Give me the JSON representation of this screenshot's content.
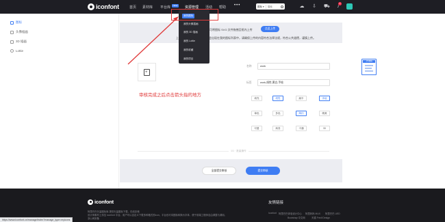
{
  "topnav": {
    "logo": "iconfont",
    "links": [
      "首页",
      "素材库",
      "平台库",
      "资源管理",
      "活动",
      "帮助"
    ],
    "new_badge": "NEW",
    "more": "•••",
    "search": {
      "select": "图标 ▾",
      "placeholder": "搜索"
    },
    "notification_count": "2"
  },
  "dropdown": {
    "items": [
      "我的图标",
      "我的头像插画",
      "我的 3D 插画",
      "我的 Lottie",
      "我的收藏",
      "我的项目"
    ]
  },
  "sidebar": {
    "items": [
      "图标",
      "头像插画",
      "3D 插画",
      "Lottie"
    ]
  },
  "main": {
    "banner_line1": "可将图标 SVG 文件拖拽至框内上传",
    "upload_button": "点此上传",
    "banner_line2": "上传后，审核通过的图标将会出现在我的图标列表中，请确保上传的内容符合法律法规，符合公共道德，谨慎上传。",
    "annotation": "审核完成之后点击箭头指的地方",
    "form": {
      "name_label": "名称",
      "name_value": "work",
      "tags_label": "标签",
      "tags_value": "work,线性,黑白,手绘"
    },
    "chips": [
      [
        "填充",
        "线性",
        "扁平",
        "手绘"
      ],
      [
        "单色",
        "多色",
        "简约",
        "精美"
      ],
      [
        "可爱",
        "商务",
        "卡通",
        "3D"
      ]
    ],
    "divider_text": "1/1 · 批量操作",
    "cancel_button": "全部提交审核",
    "confirm_button": "提交审核"
  },
  "float_card": {
    "title": "上传图标"
  },
  "footer": {
    "logo": "iconfont",
    "text1": "阿里巴巴矢量图标库 提供矢量图标下载、在线存储",
    "text2": "设计师素材上传至 iconfont 平台，用户可以自定义下载多种格式的icon，平台也可将图标转换为字体，便于前端工程师自由调整与调用。",
    "text3": "浙公网安备",
    "links_title": "友情链接",
    "links": [
      "Iconfont",
      "阿里巴巴体验设计中心",
      "阿里妈妈 MUX",
      "阿里巴巴 UED",
      "Bootstrap 中文网",
      "天猫 Fredi Design"
    ]
  },
  "status_bar": "https://www.iconfont.cn/manage/index?manage_type=myicons",
  "colors": {
    "accent": "#3f7df3",
    "annotation_red": "#e03a3a",
    "nav_bg": "#1e1e24",
    "footer_bg": "#1a1a1e"
  }
}
